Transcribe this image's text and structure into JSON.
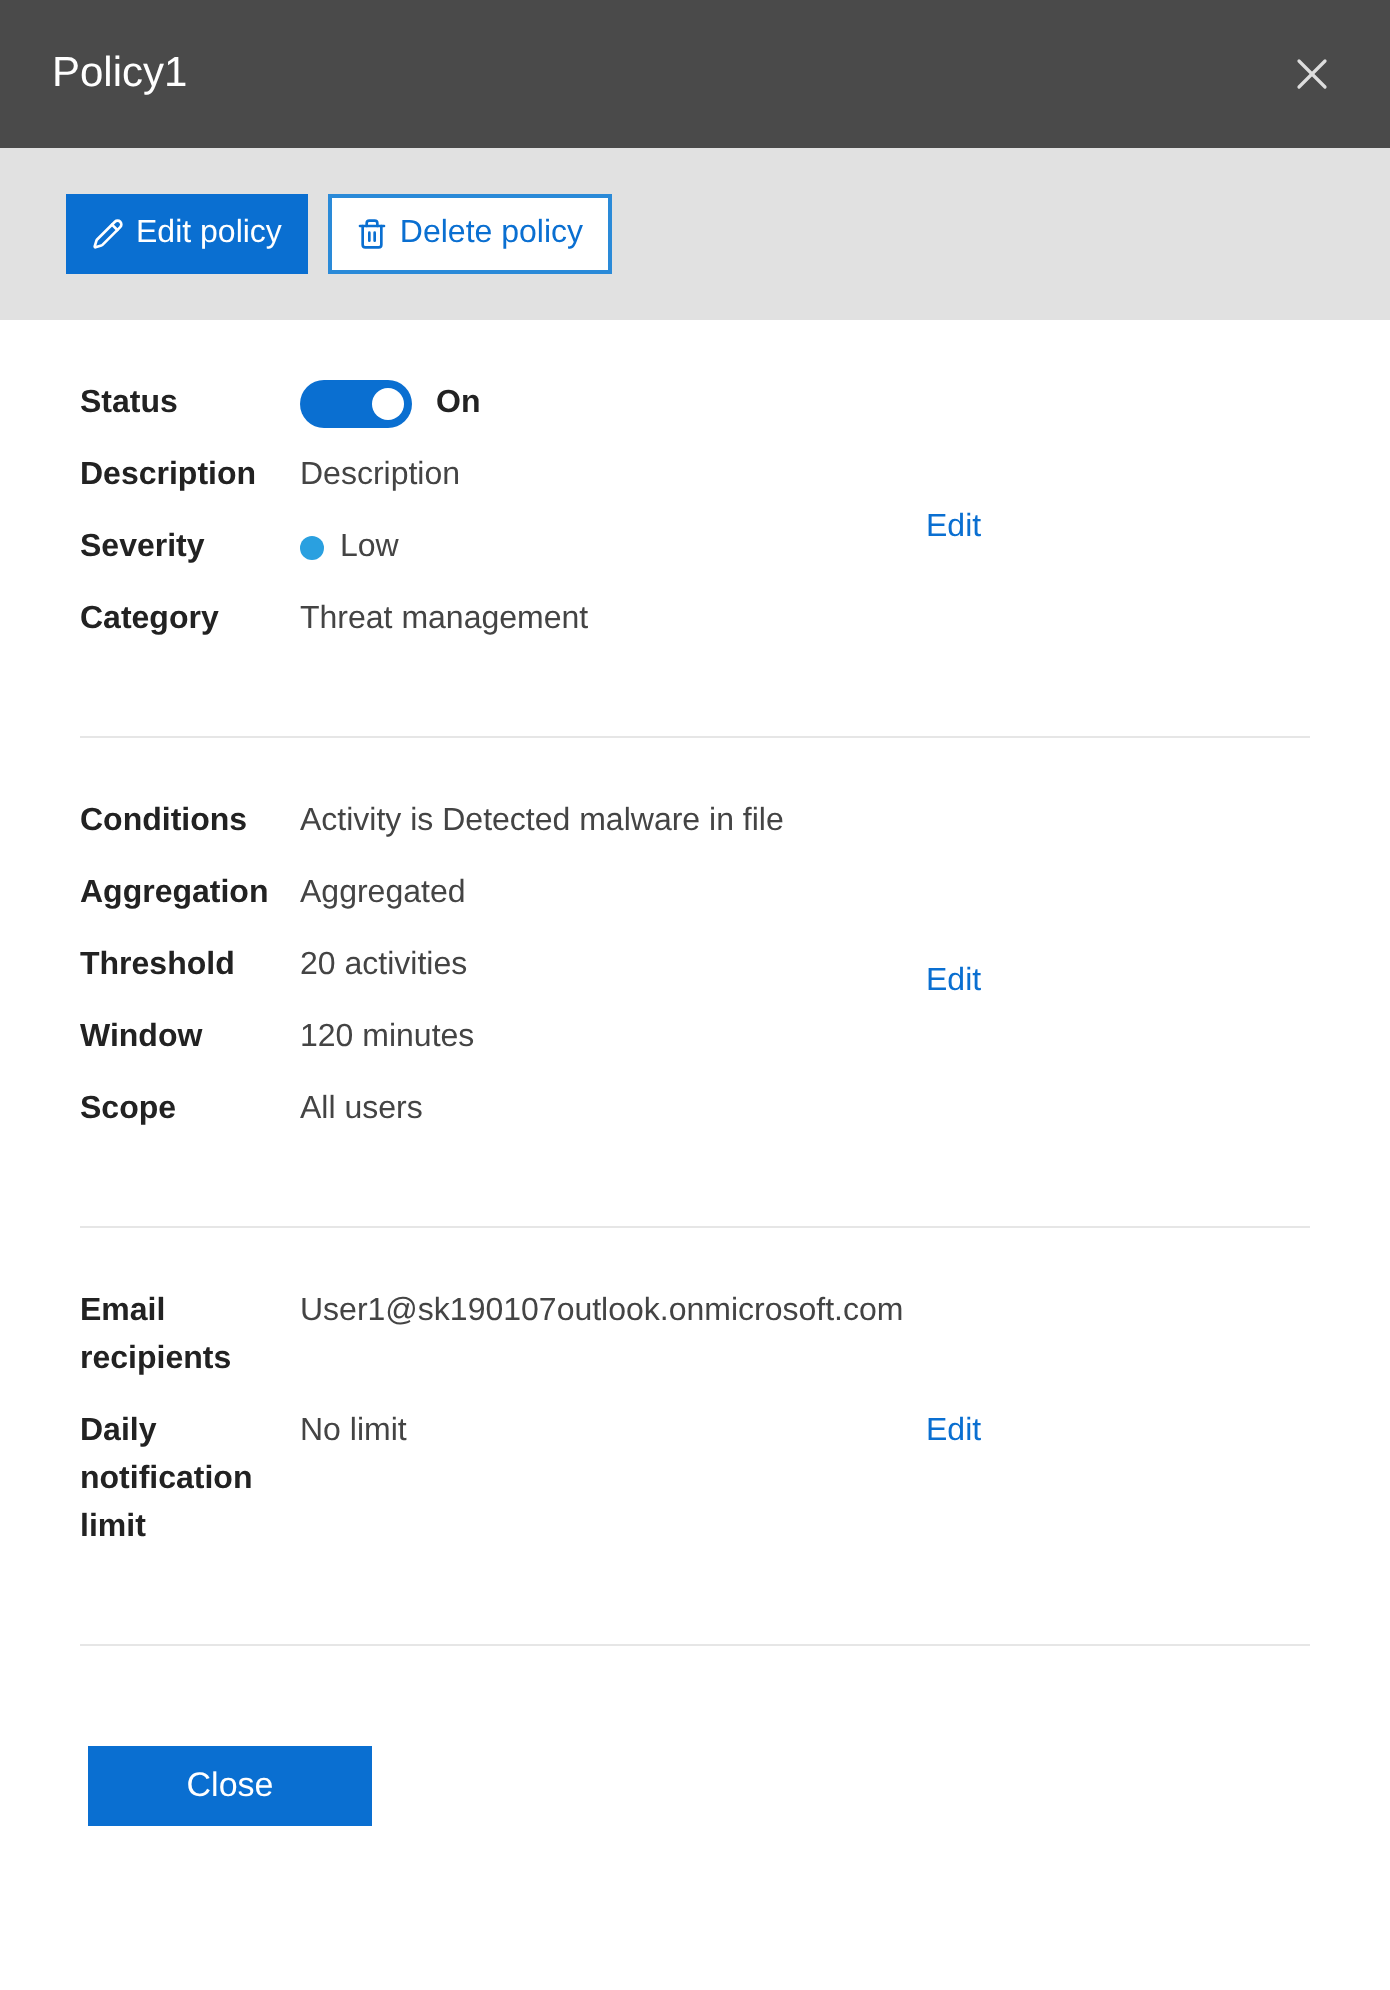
{
  "window": {
    "title": "Policy1"
  },
  "toolbar": {
    "buttons": [
      {
        "label": "Edit policy",
        "kind": "primary"
      },
      {
        "label": "Delete policy",
        "kind": "secondary"
      }
    ]
  },
  "sections": [
    {
      "rows": [
        {
          "label": "Status",
          "kind": "toggle",
          "on": true,
          "value": "On"
        },
        {
          "label": "Description",
          "kind": "text",
          "value": "Description"
        },
        {
          "label": "Severity",
          "kind": "dot",
          "color": "#2aa0e0",
          "value": "Low"
        },
        {
          "label": "Category",
          "kind": "text",
          "value": "Threat management"
        }
      ],
      "edit": "Edit"
    },
    {
      "rows": [
        {
          "label": "Conditions",
          "kind": "text",
          "value": "Activity is Detected malware in file"
        },
        {
          "label": "Aggregation",
          "kind": "text",
          "value": "Aggregated"
        },
        {
          "label": "Threshold",
          "kind": "text",
          "value": "20 activities"
        },
        {
          "label": "Window",
          "kind": "text",
          "value": "120 minutes"
        },
        {
          "label": "Scope",
          "kind": "text",
          "value": "All users"
        }
      ],
      "edit": "Edit"
    },
    {
      "rows": [
        {
          "label": "Email recipients",
          "kind": "text",
          "value": "User1@sk190107outlook.onmicrosoft.com"
        },
        {
          "label": "Daily notification limit",
          "kind": "text",
          "value": "No limit",
          "edit": "Edit"
        }
      ]
    }
  ],
  "footer": {
    "button": "Close"
  }
}
